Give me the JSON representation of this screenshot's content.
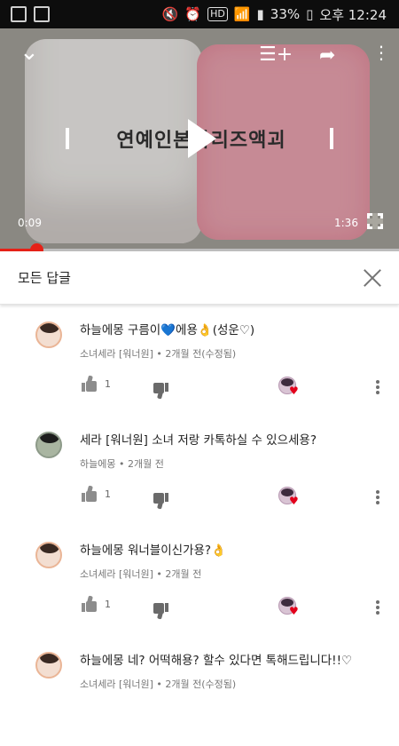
{
  "status_bar": {
    "battery": "33%",
    "time": "오후 12:24",
    "icons": [
      "gallery-icon",
      "recycle-icon",
      "mute-icon",
      "alarm-icon",
      "hd-icon",
      "wifi-icon",
      "signal-icon",
      "battery-icon"
    ],
    "hd_label": "HD"
  },
  "player": {
    "video_caption": "연예인본좌리즈액괴",
    "elapsed": "0:09",
    "duration": "1:36",
    "progress_fraction": 0.092
  },
  "replies_panel": {
    "title": "모든 답글"
  },
  "comments": [
    {
      "text": "하늘에몽 구름이💙에용👌(성운♡)",
      "meta": "소녀세라 [워너원] • 2개월 전(수정됨)",
      "likes": "1"
    },
    {
      "text": "세라 [워너원] 소녀 저랑 카톡하실 수 있으세용?",
      "meta": "하늘에몽 • 2개월 전",
      "likes": "1"
    },
    {
      "text": "하늘에몽 워너블이신가용?👌",
      "meta": "소녀세라 [워너원] • 2개월 전",
      "likes": "1"
    },
    {
      "text": "하늘에몽 네? 어떡해용? 할수 있다면 톡해드립니다!!♡",
      "meta": "소녀세라 [워너원] • 2개월 전(수정됨)",
      "likes": ""
    }
  ],
  "colors": {
    "accent_red": "#e62117",
    "creator_heart": "#e3001b"
  }
}
